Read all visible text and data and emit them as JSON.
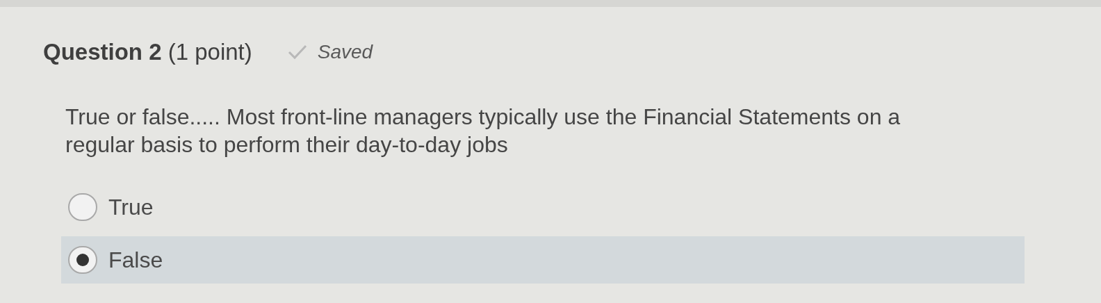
{
  "question": {
    "title": "Question 2",
    "points": "(1 point)",
    "status": "Saved"
  },
  "prompt": "True or false..... Most front-line managers typically use the Financial Statements on a regular basis to perform their day-to-day jobs",
  "options": [
    {
      "label": "True",
      "selected": false
    },
    {
      "label": "False",
      "selected": true
    }
  ]
}
